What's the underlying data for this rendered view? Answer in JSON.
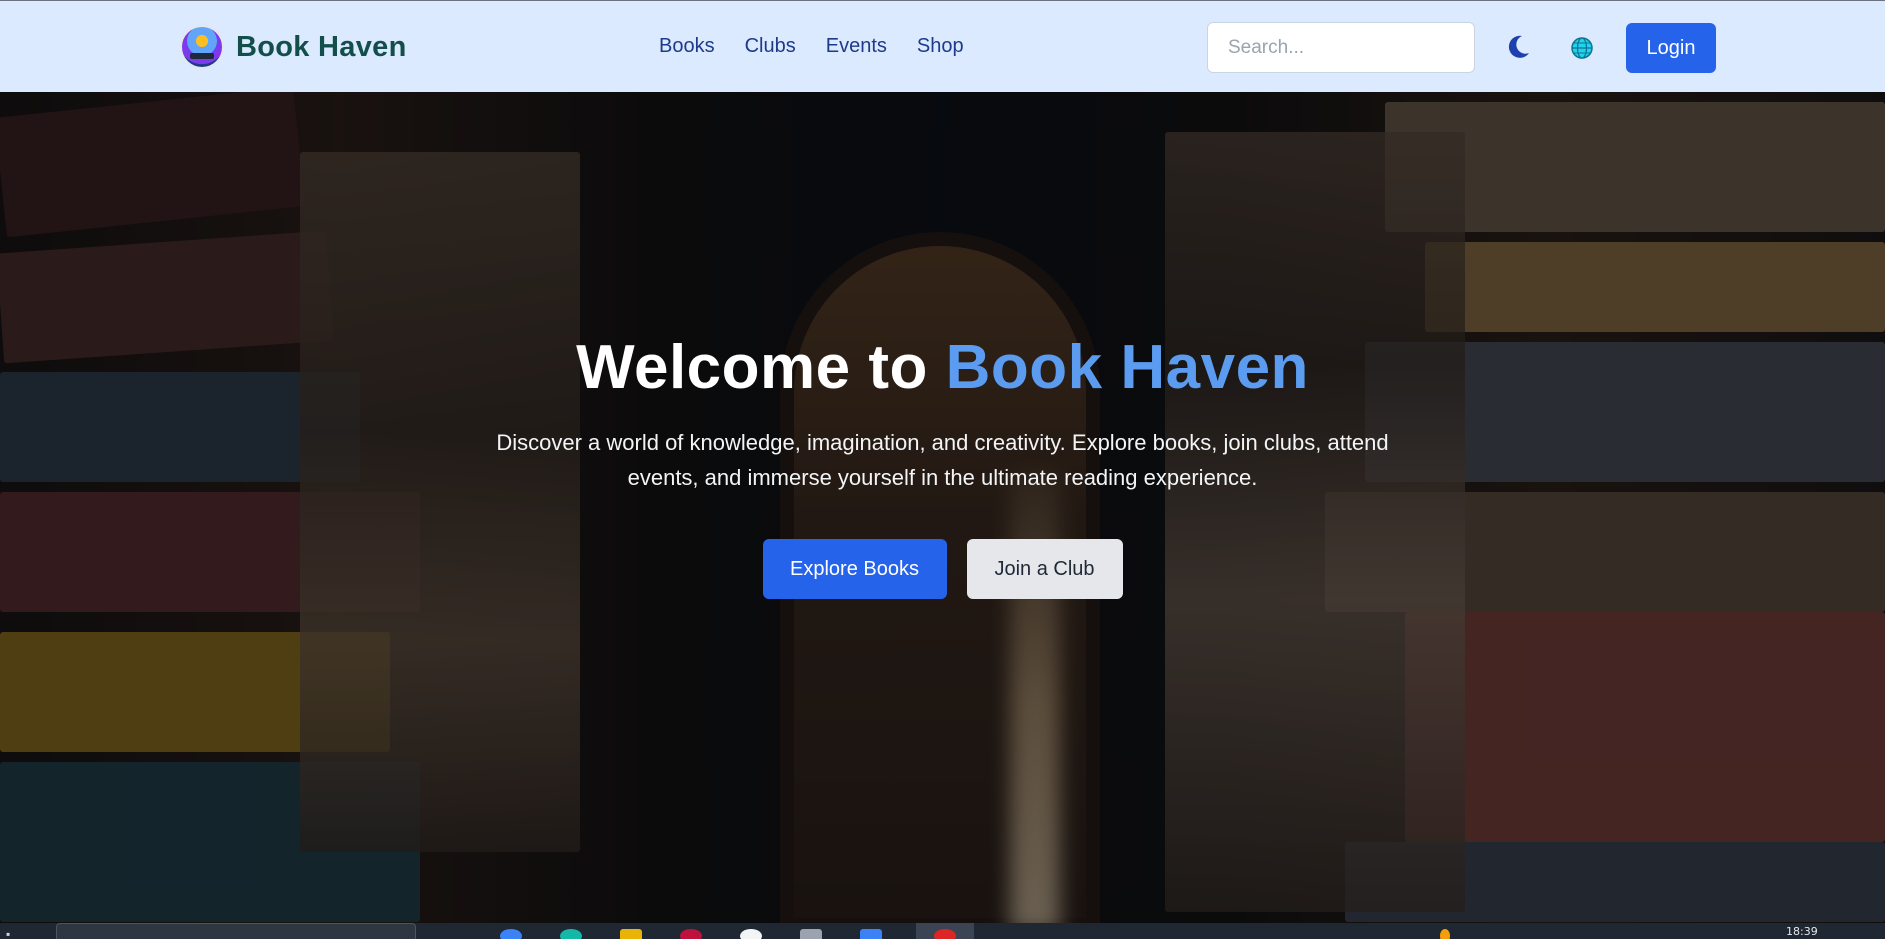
{
  "header": {
    "brand_name": "Book Haven",
    "nav": [
      "Books",
      "Clubs",
      "Events",
      "Shop"
    ],
    "search_placeholder": "Search...",
    "login_label": "Login"
  },
  "hero": {
    "title_prefix": "Welcome to ",
    "title_accent": "Book Haven",
    "subtitle": "Discover a world of knowledge, imagination, and creativity. Explore books, join clubs, attend events, and immerse yourself in the ultimate reading experience.",
    "primary_button": "Explore Books",
    "secondary_button": "Join a Club"
  },
  "taskbar": {
    "clock": "18:39"
  },
  "icons": {
    "theme_toggle": "moon-icon",
    "language": "globe-icon",
    "logo": "book-haven-logo"
  },
  "colors": {
    "header_bg": "#dbeafe",
    "brand_text": "#134e4a",
    "nav_text": "#1e3a8a",
    "primary": "#2563eb",
    "accent_text": "#5b9cf0",
    "secondary_button_bg": "#e5e7eb"
  }
}
